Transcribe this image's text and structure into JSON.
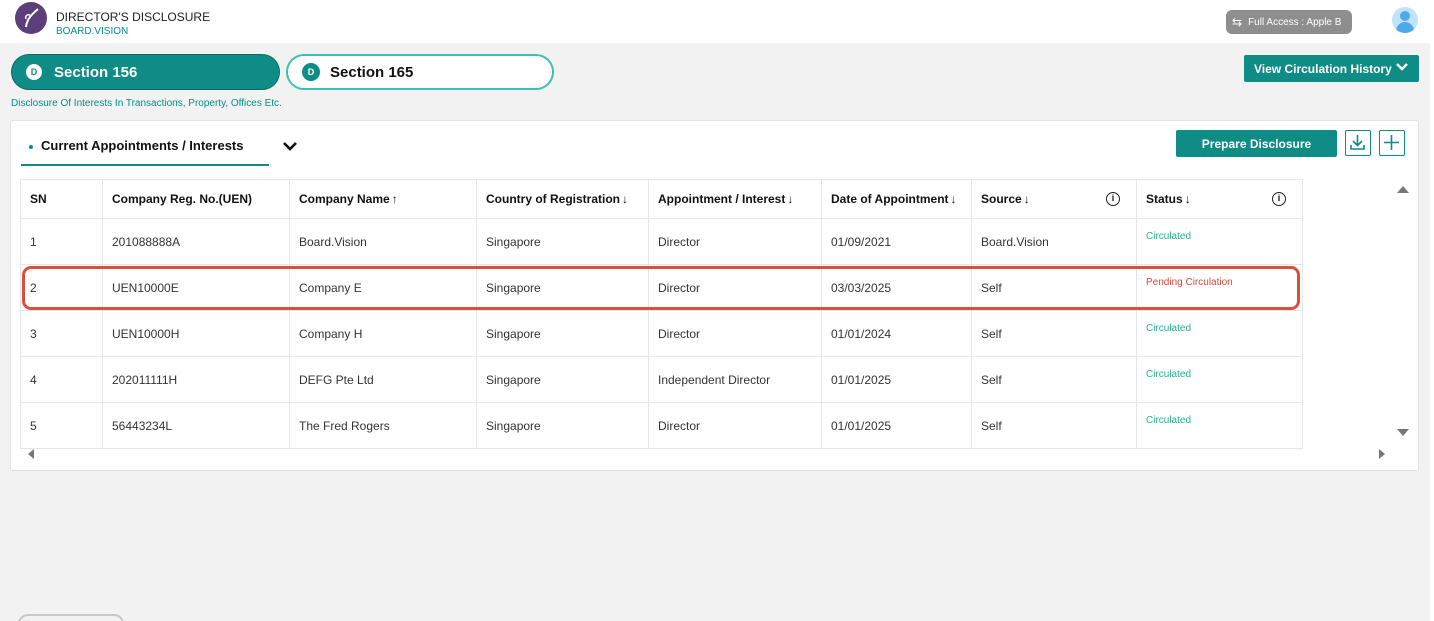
{
  "header": {
    "app_title": "DIRECTOR'S DISCLOSURE",
    "app_subtitle": "BOARD.VISION",
    "access_label": "Full Access : Apple B"
  },
  "sections": [
    {
      "badge": "D",
      "label": "Section 156",
      "active": true
    },
    {
      "badge": "D",
      "label": "Section 165",
      "active": false
    }
  ],
  "description": "Disclosure Of Interests In Transactions, Property, Offices Etc.",
  "view_history_label": "View Circulation History",
  "panel": {
    "tab_label": "Current Appointments / Interests",
    "prepare_label": "Prepare Disclosure"
  },
  "table": {
    "columns": [
      {
        "label": "SN",
        "sort": "",
        "info": false
      },
      {
        "label": "Company Reg. No.(UEN)",
        "sort": "",
        "info": false
      },
      {
        "label": "Company Name",
        "sort": "↑",
        "info": false
      },
      {
        "label": "Country of Registration",
        "sort": "↓",
        "info": false
      },
      {
        "label": "Appointment / Interest",
        "sort": "↓",
        "info": false
      },
      {
        "label": "Date of Appointment",
        "sort": "↓",
        "info": false
      },
      {
        "label": "Source",
        "sort": "↓",
        "info": true
      },
      {
        "label": "Status",
        "sort": "↓",
        "info": true
      }
    ],
    "rows": [
      {
        "sn": "1",
        "uen": "201088888A",
        "name": "Board.Vision",
        "country": "Singapore",
        "appointment": "Director",
        "date": "01/09/2021",
        "source": "Board.Vision",
        "status": "Circulated"
      },
      {
        "sn": "2",
        "uen": "UEN10000E",
        "name": "Company E",
        "country": "Singapore",
        "appointment": "Director",
        "date": "03/03/2025",
        "source": "Self",
        "status": "Pending Circulation"
      },
      {
        "sn": "3",
        "uen": "UEN10000H",
        "name": "Company H",
        "country": "Singapore",
        "appointment": "Director",
        "date": "01/01/2024",
        "source": "Self",
        "status": "Circulated"
      },
      {
        "sn": "4",
        "uen": "202011111H",
        "name": "DEFG Pte Ltd",
        "country": "Singapore",
        "appointment": "Independent Director",
        "date": "01/01/2025",
        "source": "Self",
        "status": "Circulated"
      },
      {
        "sn": "5",
        "uen": "56443234L",
        "name": "The Fred Rogers",
        "country": "Singapore",
        "appointment": "Director",
        "date": "01/01/2025",
        "source": "Self",
        "status": "Circulated"
      }
    ]
  },
  "colors": {
    "primary": "#0f8c86",
    "circulated": "#22b58a",
    "pending": "#e0463a",
    "highlight": "#d9503f"
  },
  "icons": {
    "logo": "board-vision-logo",
    "access": "swap-arrows-icon",
    "avatar": "user-avatar-icon",
    "download": "download-icon",
    "add": "plus-icon",
    "info": "info-icon"
  }
}
